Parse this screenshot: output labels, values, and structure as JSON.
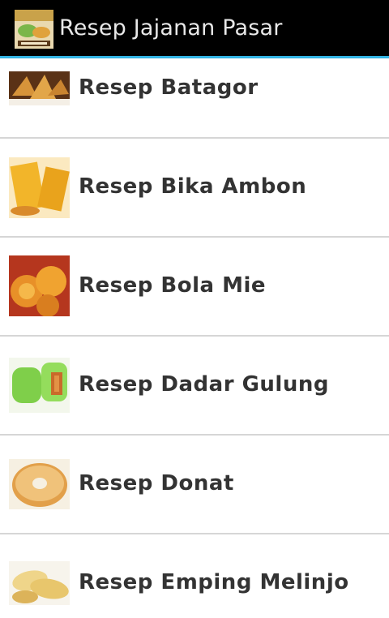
{
  "app": {
    "title": "Resep Jajanan Pasar",
    "icon": "recipe-app-icon"
  },
  "colors": {
    "action_bar": "#000000",
    "accent": "#33b5e5",
    "divider": "#d6d6d6",
    "text": "#333333"
  },
  "recipes": [
    {
      "label": "Resep Batagor",
      "icon": "batagor-thumbnail"
    },
    {
      "label": "Resep Bika Ambon",
      "icon": "bika-ambon-thumbnail"
    },
    {
      "label": "Resep Bola Mie",
      "icon": "bola-mie-thumbnail"
    },
    {
      "label": "Resep Dadar Gulung",
      "icon": "dadar-gulung-thumbnail"
    },
    {
      "label": "Resep Donat",
      "icon": "donat-thumbnail"
    },
    {
      "label": "Resep Emping Melinjo",
      "icon": "emping-melinjo-thumbnail"
    }
  ]
}
